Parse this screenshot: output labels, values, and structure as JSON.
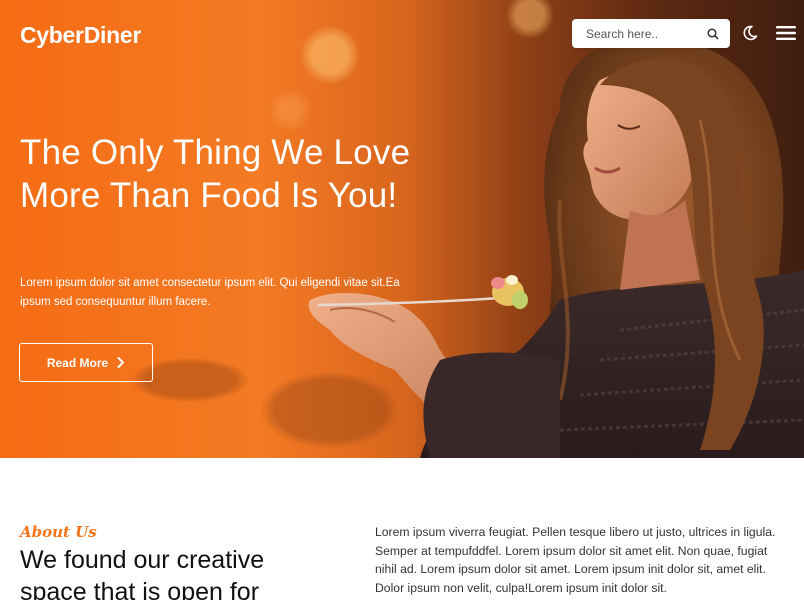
{
  "header": {
    "brand": "CyberDiner",
    "search_placeholder": "Search here..",
    "icons": [
      "search-icon",
      "moon-icon",
      "menu-icon"
    ]
  },
  "hero": {
    "title": "The Only Thing We Love More Than Food Is You!",
    "text": "Lorem ipsum dolor sit amet consectetur ipsum elit. Qui eligendi vitae sit.Ea ipsum sed consequuntur illum facere.",
    "button_label": "Read More"
  },
  "about": {
    "kicker": "About Us",
    "title": "We found our creative space that is open for",
    "text": "Lorem ipsum viverra feugiat. Pellen tesque libero ut justo, ultrices in ligula. Semper at tempufddfel. Lorem ipsum dolor sit amet elit. Non quae, fugiat nihil ad. Lorem ipsum dolor sit amet. Lorem ipsum init dolor sit, amet elit. Dolor ipsum non velit, culpa!Lorem ipsum init dolor sit."
  },
  "colors": {
    "accent": "#f5741a",
    "hero_overlay": "#f56c14"
  }
}
